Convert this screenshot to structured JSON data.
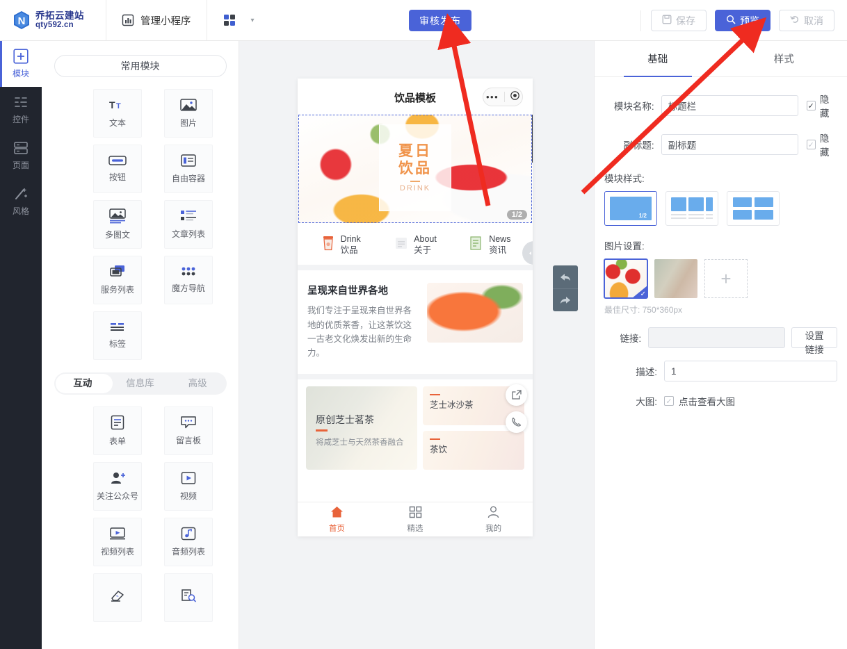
{
  "topbar": {
    "logo_line1": "乔拓云建站",
    "logo_line2": "qty592.cn",
    "manage_label": "管理小程序",
    "publish_label": "审核发布",
    "save_label": "保存",
    "preview_label": "预览",
    "cancel_label": "取消"
  },
  "rail": {
    "items": [
      {
        "label": "模块",
        "icon": "plus-square-icon"
      },
      {
        "label": "控件",
        "icon": "sliders-icon"
      },
      {
        "label": "页面",
        "icon": "pages-icon"
      },
      {
        "label": "风格",
        "icon": "magic-wand-icon"
      }
    ]
  },
  "module_panel": {
    "title": "常用模块",
    "common_modules": [
      {
        "label": "文本",
        "icon": "text-icon"
      },
      {
        "label": "图片",
        "icon": "image-icon"
      },
      {
        "label": "按钮",
        "icon": "button-icon"
      },
      {
        "label": "自由容器",
        "icon": "container-icon"
      },
      {
        "label": "多图文",
        "icon": "multi-image-text-icon"
      },
      {
        "label": "文章列表",
        "icon": "article-list-icon"
      },
      {
        "label": "服务列表",
        "icon": "service-list-icon"
      },
      {
        "label": "魔方导航",
        "icon": "grid-nav-icon"
      },
      {
        "label": "标签",
        "icon": "tag-icon"
      }
    ],
    "tabs": [
      {
        "label": "互动",
        "active": true
      },
      {
        "label": "信息库",
        "active": false
      },
      {
        "label": "高级",
        "active": false
      }
    ],
    "interactive_modules": [
      {
        "label": "表单",
        "icon": "form-icon"
      },
      {
        "label": "留言板",
        "icon": "message-board-icon"
      },
      {
        "label": "关注公众号",
        "icon": "follow-account-icon"
      },
      {
        "label": "视频",
        "icon": "video-icon"
      },
      {
        "label": "视频列表",
        "icon": "video-list-icon"
      },
      {
        "label": "音频列表",
        "icon": "audio-list-icon"
      },
      {
        "label": "",
        "icon": "eraser-icon"
      },
      {
        "label": "",
        "icon": "doc-search-icon"
      }
    ]
  },
  "phone": {
    "title": "饮品模板",
    "banner": {
      "line1": "夏日",
      "line2": "饮品",
      "line3": "DRINK",
      "counter": "1/2"
    },
    "nav": [
      {
        "en": "Drink",
        "cn": "饮品",
        "icon": "cup-icon"
      },
      {
        "en": "About",
        "cn": "关于",
        "icon": "about-icon"
      },
      {
        "en": "News",
        "cn": "资讯",
        "icon": "news-icon"
      }
    ],
    "intro": {
      "heading": "呈现来自世界各地",
      "paragraph": "我们专注于呈现来自世界各地的优质茶香，让这茶饮这一古老文化焕发出新的生命力。"
    },
    "products": {
      "big": {
        "title": "原创芝士茗茶",
        "sub": "将咸芝士与天然茶香融合"
      },
      "small": [
        {
          "title": "芝士冰沙茶"
        },
        {
          "title": "茶饮"
        }
      ]
    },
    "tabbar": [
      {
        "label": "首页",
        "icon": "home-icon",
        "active": true
      },
      {
        "label": "精选",
        "icon": "grid-icon",
        "active": false
      },
      {
        "label": "我的",
        "icon": "user-icon",
        "active": false
      }
    ]
  },
  "right_panel": {
    "tabs": [
      {
        "label": "基础",
        "active": true
      },
      {
        "label": "样式",
        "active": false
      }
    ],
    "module_name_label": "模块名称:",
    "module_name_value": "标题栏",
    "module_name_hidden_label": "隐藏",
    "subtitle_label": "副标题:",
    "subtitle_value": "副标题",
    "subtitle_hidden_label": "隐藏",
    "module_style_label": "模块样式:",
    "image_settings_label": "图片设置:",
    "best_size_hint": "最佳尺寸: 750*360px",
    "link_label": "链接:",
    "link_value": "",
    "link_placeholder": "",
    "set_link_button": "设置链接",
    "desc_label": "描述:",
    "desc_value": "1",
    "bigimage_label": "大图:",
    "bigimage_checkbox_label": "点击查看大图"
  },
  "colors": {
    "accent": "#4a63d8",
    "rail_bg": "#21252e",
    "canvas_bg": "#f2f3f5",
    "orange": "#e8633a",
    "arrow_red": "#ef2b20"
  }
}
